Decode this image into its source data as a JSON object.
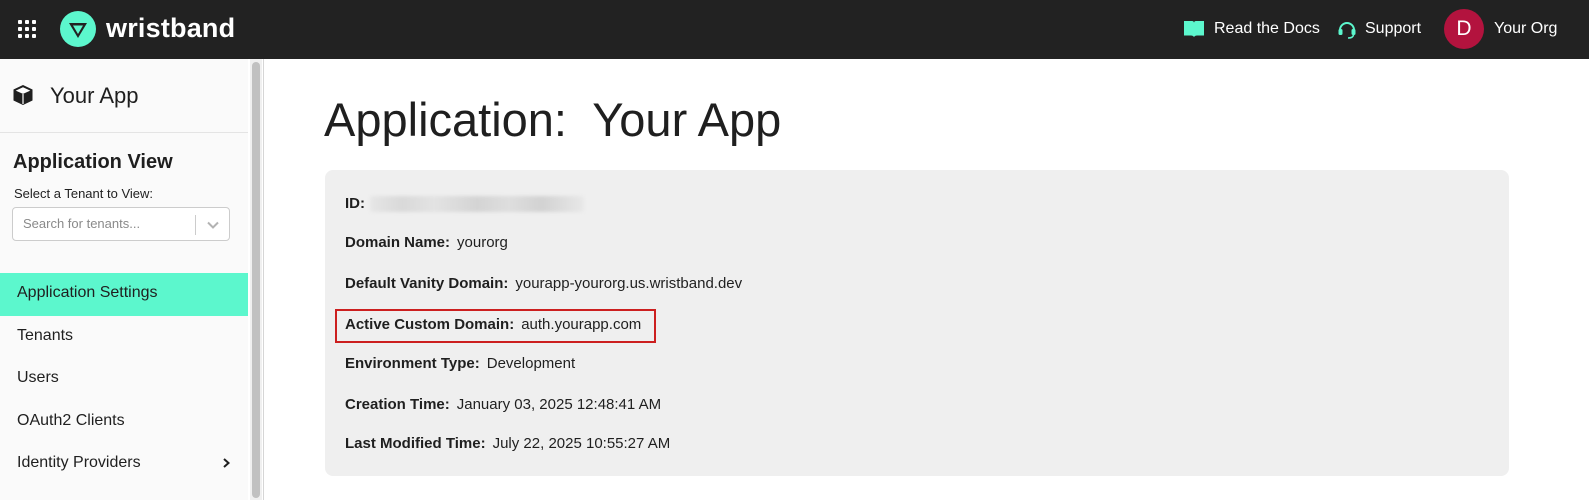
{
  "topbar": {
    "brand_name": "wristband",
    "docs_label": "Read the Docs",
    "support_label": "Support",
    "avatar_initial": "D",
    "org_name": "Your Org",
    "accent_color": "#5cf7cd",
    "avatar_color": "#b3133e"
  },
  "sidebar": {
    "app_name": "Your App",
    "view_title": "Application View",
    "tenant_label": "Select a Tenant to View:",
    "tenant_placeholder": "Search for tenants...",
    "nav": [
      {
        "label": "Application Settings",
        "active": true
      },
      {
        "label": "Tenants"
      },
      {
        "label": "Users"
      },
      {
        "label": "OAuth2 Clients"
      },
      {
        "label": "Identity Providers",
        "has_submenu": true
      }
    ]
  },
  "main": {
    "title": "Application:  Your App",
    "fields": [
      {
        "label": "ID:",
        "value": ""
      },
      {
        "label": "Domain Name:",
        "value": "yourorg"
      },
      {
        "label": "Default Vanity Domain:",
        "value": "yourapp-yourorg.us.wristband.dev"
      },
      {
        "label": "Active Custom Domain:",
        "value": "auth.yourapp.com",
        "highlighted": true
      },
      {
        "label": "Environment Type:",
        "value": "Development"
      },
      {
        "label": "Creation Time:",
        "value": "January 03, 2025 12:48:41 AM"
      },
      {
        "label": "Last Modified Time:",
        "value": "July 22, 2025 10:55:27 AM"
      }
    ]
  }
}
